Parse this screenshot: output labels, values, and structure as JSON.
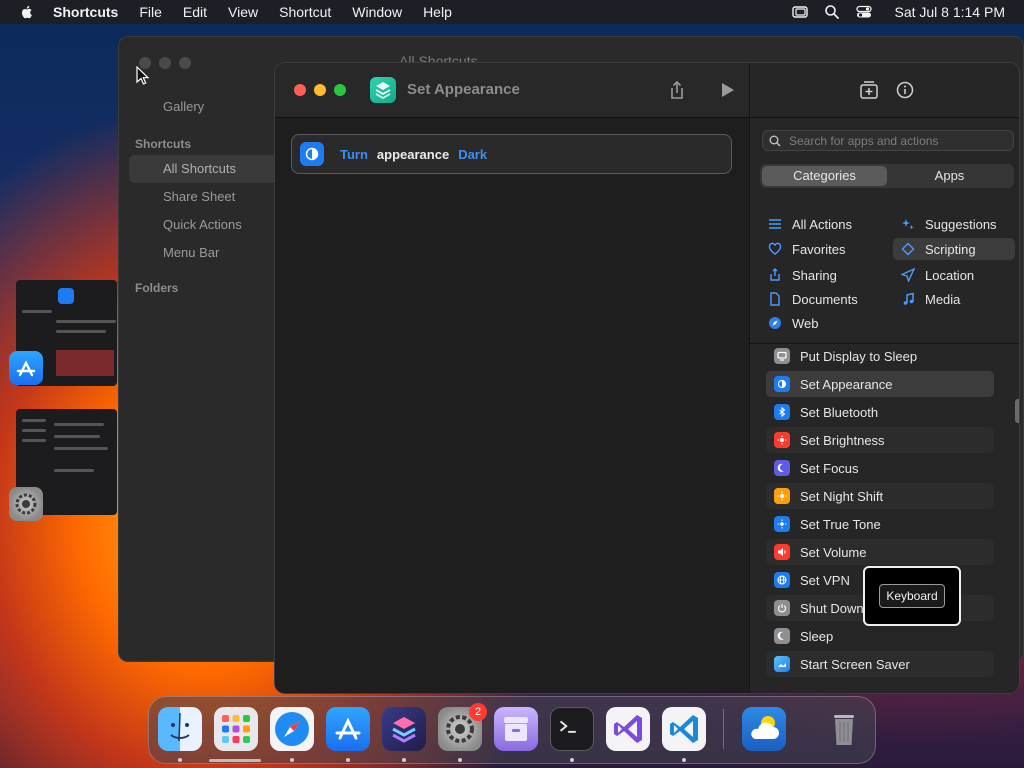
{
  "menubar": {
    "app_name": "Shortcuts",
    "items": [
      "File",
      "Edit",
      "View",
      "Shortcut",
      "Window",
      "Help"
    ],
    "clock": "Sat Jul 8  1:14 PM"
  },
  "background_window": {
    "title": "All Shortcuts",
    "gallery": "Gallery",
    "section_shortcuts": "Shortcuts",
    "items": [
      "All Shortcuts",
      "Share Sheet",
      "Quick Actions",
      "Menu Bar"
    ],
    "section_folders": "Folders"
  },
  "editor": {
    "title": "Set Appearance",
    "action": {
      "verb": "Turn",
      "param": "appearance",
      "value": "Dark"
    }
  },
  "panel": {
    "search_placeholder": "Search for apps and actions",
    "segments": [
      "Categories",
      "Apps"
    ],
    "categories_left": [
      "All Actions",
      "Favorites",
      "Sharing",
      "Documents",
      "Web"
    ],
    "categories_right": [
      "Suggestions",
      "Scripting",
      "Location",
      "Media"
    ],
    "actions": [
      "Put Display to Sleep",
      "Set Appearance",
      "Set Bluetooth",
      "Set Brightness",
      "Set Focus",
      "Set Night Shift",
      "Set True Tone",
      "Set Volume",
      "Set VPN",
      "Shut Down",
      "Sleep",
      "Start Screen Saver"
    ]
  },
  "tooltip": {
    "label": "Keyboard"
  },
  "dock": {
    "settings_badge": "2"
  },
  "colors": {
    "accent_blue": "#1e7cf2",
    "shortcuts_teal": "#1fbf9c",
    "close": "#ff5f57",
    "minimize": "#febc2e",
    "zoom": "#28c840"
  }
}
